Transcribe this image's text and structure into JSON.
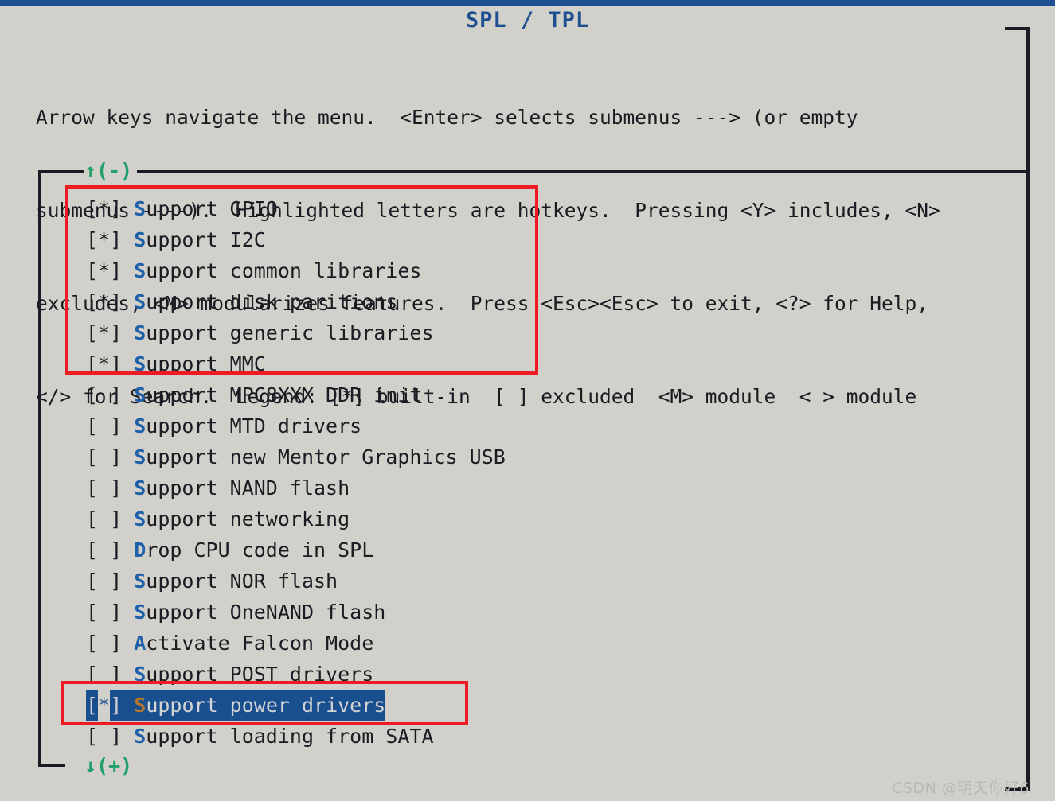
{
  "window": {
    "title": "SPL / TPL",
    "accent_color": "#1d4f91",
    "background_color": "#d1d0cb",
    "text_color": "#1b1b22",
    "hotkey_color": "#1d5fa8",
    "selection_bg_color": "#1a4f8f",
    "selection_hotkey_color": "#b5762a",
    "scroll_marker_color": "#22a06b",
    "annotation_color": "#ed1c24"
  },
  "help": {
    "line1": "Arrow keys navigate the menu.  <Enter> selects submenus ---> (or empty",
    "line2": "submenus ----).  Highlighted letters are hotkeys.  Pressing <Y> includes, <N>",
    "line3": "excludes, <M> modularizes features.  Press <Esc><Esc> to exit, <?> for Help,",
    "line4": "</> for Search.  Legend: [*] built-in  [ ] excluded  <M> module  < > module"
  },
  "scroll": {
    "up_marker": "↑(-)",
    "down_marker": "↓(+)"
  },
  "menu": {
    "items": [
      {
        "mark": "[*]",
        "hotkey": "S",
        "rest": "upport GPIO",
        "checked": true,
        "selected": false
      },
      {
        "mark": "[*]",
        "hotkey": "S",
        "rest": "upport I2C",
        "checked": true,
        "selected": false
      },
      {
        "mark": "[*]",
        "hotkey": "S",
        "rest": "upport common libraries",
        "checked": true,
        "selected": false
      },
      {
        "mark": "[*]",
        "hotkey": "S",
        "rest": "upport disk paritions",
        "checked": true,
        "selected": false
      },
      {
        "mark": "[*]",
        "hotkey": "S",
        "rest": "upport generic libraries",
        "checked": true,
        "selected": false
      },
      {
        "mark": "[*]",
        "hotkey": "S",
        "rest": "upport MMC",
        "checked": true,
        "selected": false
      },
      {
        "mark": "[ ]",
        "hotkey": "S",
        "rest": "upport MPC8XXX DDR init",
        "checked": false,
        "selected": false
      },
      {
        "mark": "[ ]",
        "hotkey": "S",
        "rest": "upport MTD drivers",
        "checked": false,
        "selected": false
      },
      {
        "mark": "[ ]",
        "hotkey": "S",
        "rest": "upport new Mentor Graphics USB",
        "checked": false,
        "selected": false
      },
      {
        "mark": "[ ]",
        "hotkey": "S",
        "rest": "upport NAND flash",
        "checked": false,
        "selected": false
      },
      {
        "mark": "[ ]",
        "hotkey": "S",
        "rest": "upport networking",
        "checked": false,
        "selected": false
      },
      {
        "mark": "[ ]",
        "hotkey": "D",
        "rest": "rop CPU code in SPL",
        "checked": false,
        "selected": false
      },
      {
        "mark": "[ ]",
        "hotkey": "S",
        "rest": "upport NOR flash",
        "checked": false,
        "selected": false
      },
      {
        "mark": "[ ]",
        "hotkey": "S",
        "rest": "upport OneNAND flash",
        "checked": false,
        "selected": false
      },
      {
        "mark": "[ ]",
        "hotkey": "A",
        "rest": "ctivate Falcon Mode",
        "checked": false,
        "selected": false
      },
      {
        "mark": "[ ]",
        "hotkey": "S",
        "rest": "upport POST drivers",
        "checked": false,
        "selected": false
      },
      {
        "mark": "[*]",
        "hotkey": "S",
        "rest": "upport power drivers",
        "checked": true,
        "selected": true
      },
      {
        "mark": "[ ]",
        "hotkey": "S",
        "rest": "upport loading from SATA",
        "checked": false,
        "selected": false
      }
    ]
  },
  "watermark": {
    "text": "CSDN @明天你好6"
  }
}
